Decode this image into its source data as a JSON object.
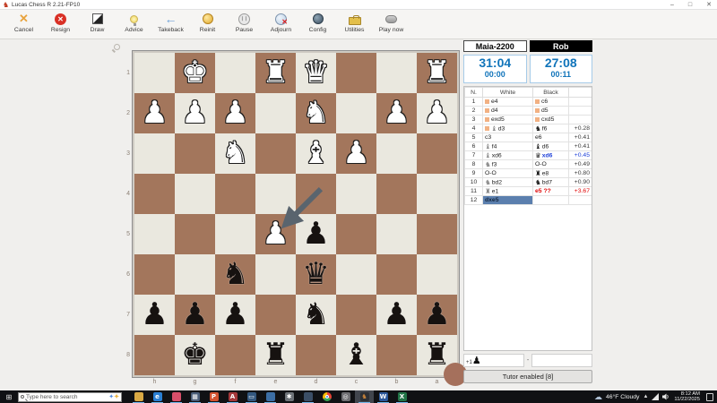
{
  "window": {
    "title": "Lucas Chess R 2.21-FP10",
    "minimize": "–",
    "maximize": "□",
    "close": "✕"
  },
  "toolbar": {
    "items": [
      {
        "label": "Cancel",
        "icon": "cancel-icon"
      },
      {
        "label": "Resign",
        "icon": "resign-icon"
      },
      {
        "label": "Draw",
        "icon": "draw-icon"
      },
      {
        "label": "Advice",
        "icon": "advice-lightbulb-icon"
      },
      {
        "label": "Takeback",
        "icon": "takeback-arrow-icon"
      },
      {
        "label": "Reinit",
        "icon": "reinit-icon"
      },
      {
        "label": "Pause",
        "icon": "pause-icon"
      },
      {
        "label": "Adjourn",
        "icon": "adjourn-icon"
      },
      {
        "label": "Config",
        "icon": "config-icon"
      },
      {
        "label": "Utilities",
        "icon": "utilities-toolbox-icon"
      },
      {
        "label": "Play now",
        "icon": "play-now-icon"
      }
    ]
  },
  "board": {
    "files": [
      "h",
      "g",
      "f",
      "e",
      "d",
      "c",
      "b",
      "a"
    ],
    "ranks": [
      "1",
      "2",
      "3",
      "4",
      "5",
      "6",
      "7",
      "8"
    ],
    "light_color": "#eae8df",
    "dark_color": "#a3765c",
    "arrow": {
      "from": "d4",
      "to": "e5",
      "color": "#59646e"
    },
    "pieces": [
      {
        "square": "g1",
        "piece": "wK"
      },
      {
        "square": "e1",
        "piece": "wR"
      },
      {
        "square": "d1",
        "piece": "wQ"
      },
      {
        "square": "a1",
        "piece": "wR"
      },
      {
        "square": "h2",
        "piece": "wP"
      },
      {
        "square": "g2",
        "piece": "wP"
      },
      {
        "square": "f2",
        "piece": "wP"
      },
      {
        "square": "d2",
        "piece": "wN"
      },
      {
        "square": "b2",
        "piece": "wP"
      },
      {
        "square": "a2",
        "piece": "wP"
      },
      {
        "square": "f3",
        "piece": "wN"
      },
      {
        "square": "d3",
        "piece": "wB"
      },
      {
        "square": "c3",
        "piece": "wP"
      },
      {
        "square": "e5",
        "piece": "wP"
      },
      {
        "square": "d5",
        "piece": "bP"
      },
      {
        "square": "f6",
        "piece": "bN"
      },
      {
        "square": "d6",
        "piece": "bQ"
      },
      {
        "square": "h7",
        "piece": "bP"
      },
      {
        "square": "g7",
        "piece": "bP"
      },
      {
        "square": "f7",
        "piece": "bP"
      },
      {
        "square": "d7",
        "piece": "bN"
      },
      {
        "square": "b7",
        "piece": "bP"
      },
      {
        "square": "a7",
        "piece": "bP"
      },
      {
        "square": "g8",
        "piece": "bK"
      },
      {
        "square": "e8",
        "piece": "bR"
      },
      {
        "square": "c8",
        "piece": "bB"
      },
      {
        "square": "a8",
        "piece": "bR"
      }
    ]
  },
  "panel": {
    "players": {
      "white": "Maia-2200",
      "black": "Rob"
    },
    "clocks": {
      "white": {
        "main": "31:04",
        "sub": "00:00"
      },
      "black": {
        "main": "27:08",
        "sub": "00:11"
      }
    },
    "moves": {
      "headers": [
        "N.",
        "White",
        "Black"
      ],
      "rows": [
        {
          "n": "1",
          "w": {
            "book": true,
            "t": "e4"
          },
          "b": {
            "book": true,
            "t": "c6"
          },
          "ev": ""
        },
        {
          "n": "2",
          "w": {
            "book": true,
            "t": "d4"
          },
          "b": {
            "book": true,
            "t": "d5"
          },
          "ev": ""
        },
        {
          "n": "3",
          "w": {
            "book": true,
            "t": "exd5"
          },
          "b": {
            "book": true,
            "t": "cxd5"
          },
          "ev": ""
        },
        {
          "n": "4",
          "w": {
            "book": true,
            "icon": "wB",
            "t": "d3"
          },
          "b": {
            "icon": "bN",
            "t": "f6"
          },
          "ev": "+0.28"
        },
        {
          "n": "5",
          "w": {
            "t": "c3"
          },
          "b": {
            "t": "e6"
          },
          "ev": "+0.41"
        },
        {
          "n": "6",
          "w": {
            "icon": "wB",
            "t": "f4"
          },
          "b": {
            "icon": "bB",
            "t": "d6"
          },
          "ev": "+0.41"
        },
        {
          "n": "7",
          "w": {
            "icon": "wB",
            "t": "xd6"
          },
          "b": {
            "icon": "bQ",
            "t": "xd6",
            "cls": "blue"
          },
          "ev": "+0.45",
          "evCls": "blue"
        },
        {
          "n": "8",
          "w": {
            "icon": "wN",
            "t": "f3"
          },
          "b": {
            "t": "O-O"
          },
          "ev": "+0.49"
        },
        {
          "n": "9",
          "w": {
            "t": "O-O"
          },
          "b": {
            "icon": "bR",
            "t": "e8"
          },
          "ev": "+0.80"
        },
        {
          "n": "10",
          "w": {
            "icon": "wN",
            "t": "bd2"
          },
          "b": {
            "icon": "bN",
            "t": "bd7"
          },
          "ev": "+0.90"
        },
        {
          "n": "11",
          "w": {
            "icon": "wR",
            "t": "e1"
          },
          "b": {
            "t": "e5 ??",
            "cls": "red"
          },
          "ev": "+3.67",
          "evCls": "red"
        },
        {
          "n": "12",
          "w": {
            "t": "dxe5",
            "sel": true
          },
          "b": {
            "t": ""
          },
          "ev": ""
        }
      ]
    },
    "material": {
      "advantage": "+1",
      "piece": "bP",
      "separator": "-"
    },
    "tutor_button": "Tutor enabled [8]"
  },
  "taskbar": {
    "search_placeholder": "Type here to search",
    "icons": [
      {
        "name": "file-explorer-icon",
        "bg": "#d9a944",
        "glyph": "",
        "running": true
      },
      {
        "name": "browser-globe-icon",
        "bg": "#2a7fd4",
        "glyph": "e",
        "running": true
      },
      {
        "name": "app-red-icon",
        "bg": "#d94f6a",
        "glyph": "",
        "running": true
      },
      {
        "name": "calculator-icon",
        "bg": "#4a5d78",
        "glyph": "▦",
        "running": true
      },
      {
        "name": "powerpoint-icon",
        "bg": "#d35230",
        "glyph": "P",
        "running": true
      },
      {
        "name": "access-icon",
        "bg": "#a4373a",
        "glyph": "A",
        "running": true
      },
      {
        "name": "printer-icon",
        "bg": "#33577e",
        "glyph": "▭",
        "running": true
      },
      {
        "name": "app-blue-icon",
        "bg": "#3c6ea5",
        "glyph": "",
        "running": true
      },
      {
        "name": "settings-gear-icon",
        "bg": "#6d7278",
        "glyph": "✱",
        "running": false
      },
      {
        "name": "sphere-app-icon",
        "bg": "#3b4e66",
        "glyph": "",
        "running": true
      },
      {
        "name": "chrome-icon",
        "bg": "chrome",
        "glyph": "",
        "running": false
      },
      {
        "name": "dial-gray-icon",
        "bg": "#6e6e72",
        "glyph": "◎",
        "running": false
      },
      {
        "name": "lucas-chess-knight-icon",
        "bg": "#2c2f35",
        "glyph": "♞",
        "running": true,
        "active": true,
        "fg": "#c8833a"
      },
      {
        "name": "word-icon",
        "bg": "#2b579a",
        "glyph": "W",
        "running": true
      },
      {
        "name": "excel-icon",
        "bg": "#217346",
        "glyph": "X",
        "running": true
      }
    ],
    "tray": {
      "weather": "46°F Cloudy",
      "time": "8:12 AM",
      "date": "11/22/2025"
    }
  }
}
